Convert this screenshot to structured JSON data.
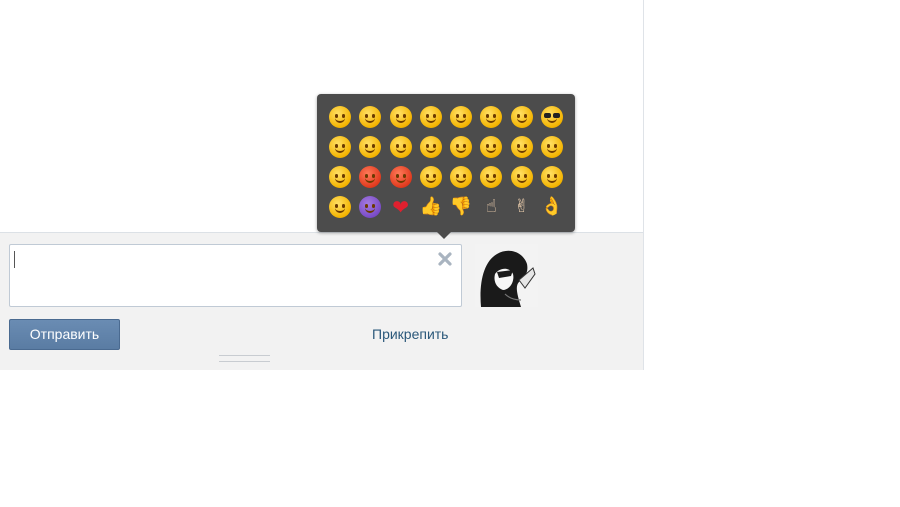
{
  "compose": {
    "message_value": "",
    "send_label": "Отправить",
    "attach_label": "Прикрепить"
  },
  "emoji_picker": {
    "rows": [
      [
        "smiling-face",
        "grinning-face",
        "winking-face",
        "laughing-face",
        "face-with-tongue",
        "yum-face",
        "heart-eyes-face",
        "sunglasses-face"
      ],
      [
        "unamused-face",
        "smirking-face",
        "pensive-face",
        "crying-face",
        "sobbing-face",
        "weary-face",
        "fearful-face",
        "neutral-face"
      ],
      [
        "relieved-face",
        "angry-face",
        "pouting-face",
        "innocent-face",
        "cold-sweat-face",
        "flushed-face",
        "astonished-face",
        "mask-face"
      ],
      [
        "kissing-face",
        "imp-face",
        "red-heart",
        "thumbs-up",
        "thumbs-down",
        "index-pointing-up",
        "victory-hand",
        "ok-hand"
      ]
    ]
  },
  "icons": {
    "clear": "close-icon",
    "avatar": "user-avatar"
  },
  "colors": {
    "send_button": "#5b7fa6",
    "attach_link": "#2b587a",
    "popup_bg": "#4c4c4c"
  }
}
